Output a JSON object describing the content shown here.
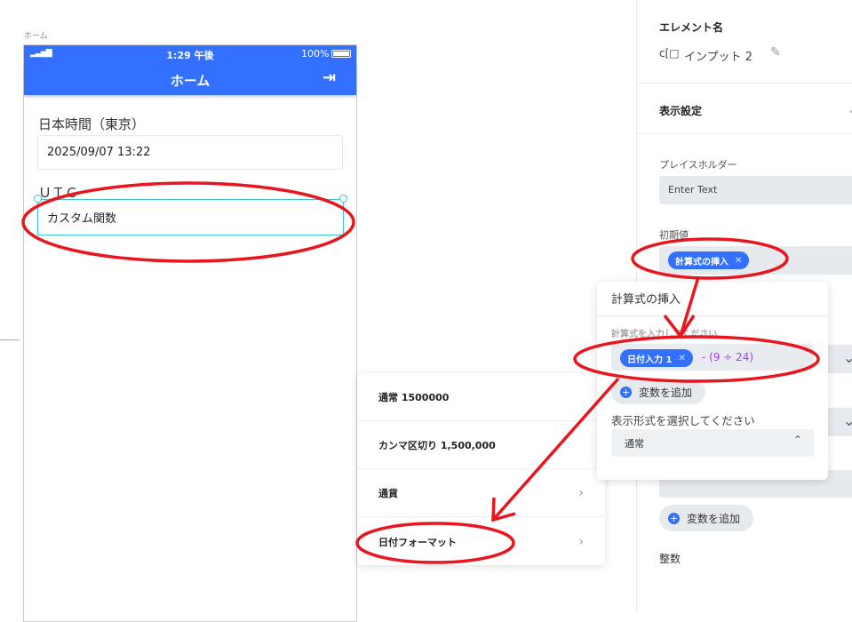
{
  "canvas": {
    "screen_label": "ホーム"
  },
  "phone": {
    "status": {
      "time": "1:29 午後",
      "battery": "100%"
    },
    "nav": {
      "title": "ホーム",
      "icon": "logout-icon"
    },
    "fields": [
      {
        "label": "日本時間（東京）",
        "value": "2025/09/07 13:22"
      },
      {
        "label": "ＵＴＣ",
        "value": "カスタム関数"
      }
    ]
  },
  "panel": {
    "element_name_title": "エレメント名",
    "element_name": "インプット 2",
    "display_settings": "表示設定",
    "placeholder_label": "プレイスホルダー",
    "placeholder_value": "Enter Text",
    "initial_label": "初期値",
    "initial_chip": "計算式の挿入",
    "add_variable": "変数を追加",
    "integer_label": "整数"
  },
  "popup": {
    "title": "計算式の挿入",
    "formula_label": "計算式を入力してください",
    "chip": "日付入力 1",
    "formula_rest": "- (9 ÷ 24)",
    "add_variable": "変数を追加",
    "format_label": "表示形式を選択してください",
    "format_value": "通常"
  },
  "format_menu": {
    "items": [
      "通常 1500000",
      "カンマ区切り 1,500,000",
      "通貨",
      "日付フォーマット"
    ]
  },
  "colors": {
    "brand": "#3370ff",
    "annotation": "#e8161e",
    "selection": "#3cc4d4"
  }
}
